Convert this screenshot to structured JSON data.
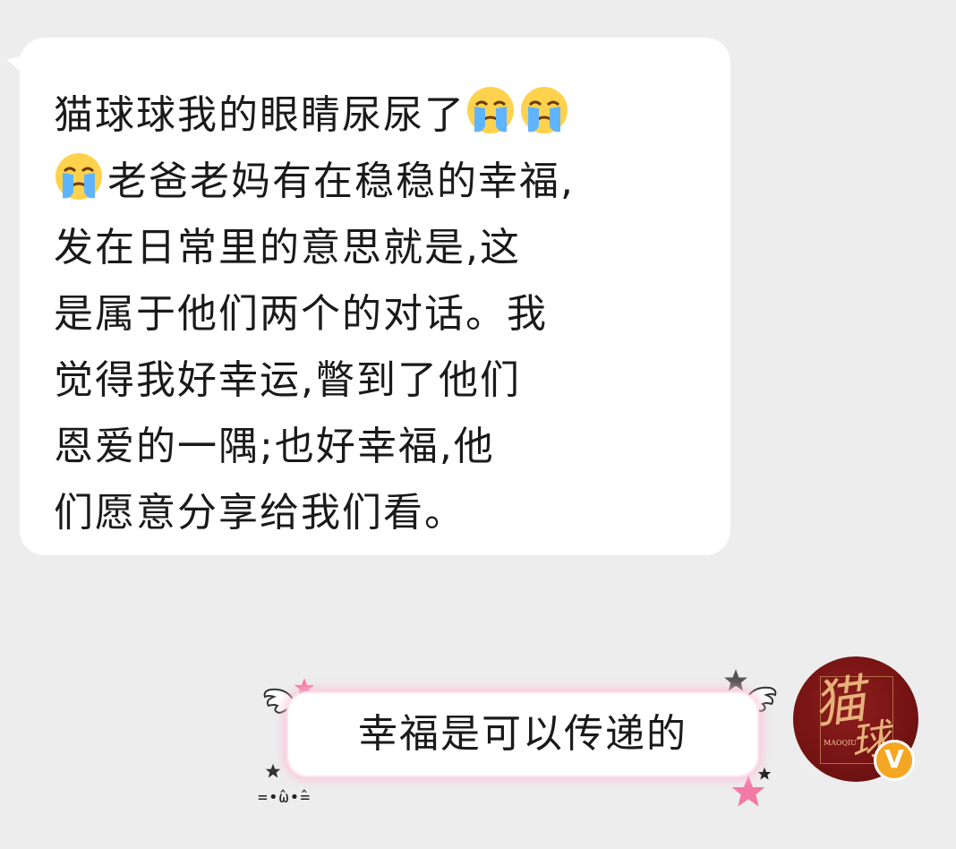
{
  "incoming_message": {
    "segments": [
      {
        "text": "猫球球我的眼睛尿尿了",
        "emojis_after": 2
      },
      {
        "emojis_before": 1,
        "text": "老爸老妈有在稳稳的幸福,"
      },
      {
        "text": "发在日常里的意思就是,这"
      },
      {
        "text": "是属于他们两个的对话。我"
      },
      {
        "text": "觉得我好幸运,瞥到了他们"
      },
      {
        "text": "恩爱的一隅;也好幸福,他"
      },
      {
        "text": "们愿意分享给我们看。"
      }
    ],
    "emoji_name": "loudly-crying-emoji"
  },
  "outgoing_message": {
    "text": "幸福是可以传递的",
    "kaomoji": "=•̂ω•̂=",
    "bubble_glow_color": "#ffc2d8"
  },
  "avatar": {
    "big_text": "猫",
    "big_text_2": "球",
    "small_text": "MAOQIU",
    "badge": "V",
    "badge_color": "#f5a623",
    "background_color": "#741313"
  },
  "colors": {
    "background": "#ededed",
    "bubble": "#ffffff",
    "text": "#1a1a1a",
    "pink_star": "#f37aa4",
    "gray_star": "#555555"
  }
}
